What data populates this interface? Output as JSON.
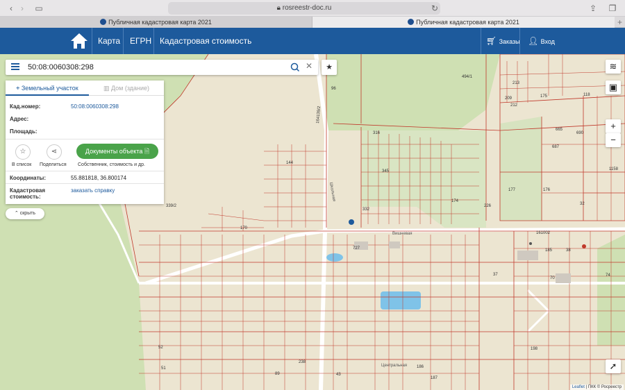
{
  "browser": {
    "url": "rosreestr-doc.ru",
    "tabs": [
      {
        "label": "Публичная кадастровая карта 2021"
      },
      {
        "label": "Публичная кадастровая карта 2021"
      }
    ],
    "new_tab": "+"
  },
  "nav": {
    "items": [
      "Карта",
      "ЕГРН",
      "Кадастровая стоимость"
    ],
    "orders": "Заказы",
    "login": "Вход"
  },
  "search": {
    "value": "50:08:0060308:298"
  },
  "panel": {
    "tab_active": "Земельный участок",
    "tab_inactive": "Дом (здание)",
    "kad_label": "Кад.номер:",
    "kad_value": "50:08:0060308:298",
    "address_label": "Адрес:",
    "area_label": "Площадь:",
    "list_label": "В список",
    "share_label": "Поделиться",
    "docs_button": "Документы объекта",
    "docs_caption": "Собственник, стоимость и др.",
    "coords_label": "Координаты:",
    "coords_value": "55.881818, 36.800174",
    "cost_label_1": "Кадастровая",
    "cost_label_2": "стоимость:",
    "cost_link": "заказать справку",
    "hide_label": "скрыть"
  },
  "map": {
    "labels": [
      "494/1",
      "118",
      "175",
      "690",
      "665",
      "687",
      "1158",
      "177",
      "176",
      "32",
      "174",
      "226",
      "161002",
      "185",
      "38",
      "70",
      "74",
      "37",
      "727",
      "339/2",
      "170",
      "345",
      "332",
      "316",
      "96",
      "164139/2",
      "198",
      "238",
      "43",
      "144",
      "212",
      "213",
      "209",
      "186",
      "187",
      "51",
      "89",
      "52"
    ],
    "streets": [
      "Вишневая",
      "Центральная",
      "Школьная"
    ],
    "attribution_leaflet": "Leaflet",
    "attribution_rest": "| ПКК © Росреестр"
  },
  "colors": {
    "nav": "#1d5a9c",
    "parcel": "#c0392b",
    "green": "#cfe0b3",
    "doc_button": "#4aa34a"
  }
}
